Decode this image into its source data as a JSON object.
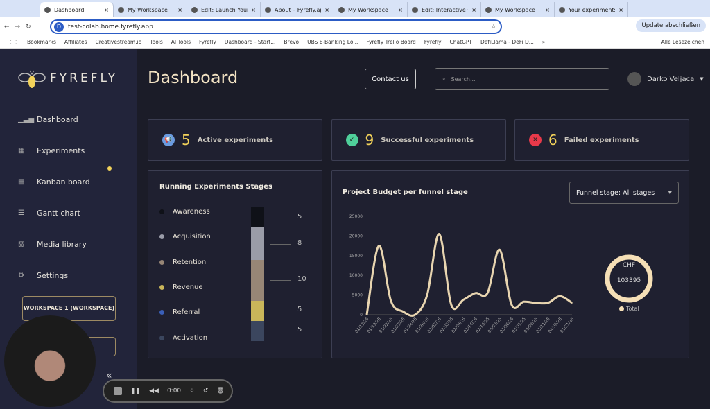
{
  "browser": {
    "tabs": [
      {
        "title": "Dashboard",
        "active": true
      },
      {
        "title": "My Workspace"
      },
      {
        "title": "Edit: Launch Your"
      },
      {
        "title": "About – Fyrefly.ap"
      },
      {
        "title": "My Workspace"
      },
      {
        "title": "Edit: Interactive G"
      },
      {
        "title": "My Workspace"
      },
      {
        "title": "Your experiments"
      }
    ],
    "url": "test-colab.home.fyrefly.app",
    "update_button": "Update abschließen",
    "bookmarks": [
      "Bookmarks",
      "Affiliates",
      "Creativestream.io",
      "Tools",
      "AI Tools",
      "Fyrefly",
      "Dashboard - Start...",
      "Brevo",
      "UBS E-Banking Lo...",
      "Fyrefly Trello Board",
      "Fyrefly",
      "ChatGPT",
      "DefiLlama - DeFi D..."
    ],
    "more_bookmarks": "»",
    "all_bookmarks": "Alle Lesezeichen"
  },
  "sidebar": {
    "logo": "FYREFLY",
    "items": [
      {
        "label": "Dashboard",
        "icon": "bar-chart-icon",
        "active": true
      },
      {
        "label": "Experiments",
        "icon": "grid-icon"
      },
      {
        "label": "Kanban board",
        "icon": "kanban-icon"
      },
      {
        "label": "Gantt chart",
        "icon": "gantt-icon"
      },
      {
        "label": "Media library",
        "icon": "image-icon"
      },
      {
        "label": "Settings",
        "icon": "gear-icon"
      }
    ],
    "workspace": "WORKSPACE 1 (WORKSPACE)",
    "accent": "#f2d25a"
  },
  "header": {
    "title": "Dashboard",
    "contact": "Contact us",
    "search_placeholder": "Search...",
    "user": "Darko Veljaca"
  },
  "stats": [
    {
      "value": "5",
      "label": "Active experiments",
      "icon": "megaphone-icon",
      "color": "#6a9be0"
    },
    {
      "value": "9",
      "label": "Successful experiments",
      "icon": "check-icon",
      "color": "#4fcf9a"
    },
    {
      "value": "6",
      "label": "Failed experiments",
      "icon": "x-icon",
      "color": "#e8394a"
    }
  ],
  "stages": {
    "title": "Running Experiments Stages",
    "items": [
      {
        "label": "Awareness",
        "value": 5,
        "color": "#0f1118"
      },
      {
        "label": "Acquisition",
        "value": 8,
        "color": "#9a9ca8"
      },
      {
        "label": "Retention",
        "value": 10,
        "color": "#978676"
      },
      {
        "label": "Revenue",
        "value": 5,
        "color": "#c9b65a"
      },
      {
        "label": "Referral",
        "value": null,
        "color": "#3a5fb8"
      },
      {
        "label": "Activation",
        "value": 5,
        "color": "#3b465e"
      }
    ]
  },
  "budget": {
    "title": "Project Budget per funnel stage",
    "select": "Funnel stage: All stages",
    "total_currency": "CHF",
    "total_value": "103395",
    "total_label": "Total"
  },
  "chart_data": {
    "type": "line",
    "title": "Project Budget per funnel stage",
    "x": [
      "01/13/25",
      "01/19/25",
      "01/22/25",
      "01/23/25",
      "01/24/25",
      "01/26/25",
      "02/02/25",
      "02/03/25",
      "02/09/25",
      "02/14/25",
      "02/16/25",
      "03/03/25",
      "03/06/25",
      "03/07/25",
      "03/09/25",
      "03/11/25",
      "04/06/25",
      "01/21/35"
    ],
    "values": [
      0,
      17500,
      3500,
      800,
      0,
      5000,
      20500,
      2500,
      3800,
      5500,
      5500,
      16500,
      2500,
      3300,
      3000,
      3000,
      4700,
      3000
    ],
    "yticks": [
      0,
      5000,
      10000,
      15000,
      20000,
      25000
    ],
    "ylim": [
      0,
      25000
    ],
    "color": "#e8d5b0",
    "grid": false
  },
  "recorder": {
    "time": "0:00"
  }
}
